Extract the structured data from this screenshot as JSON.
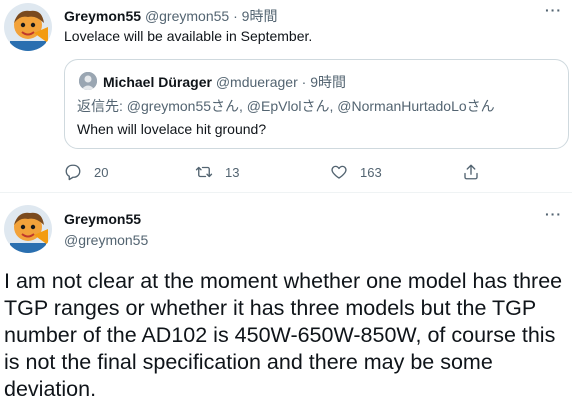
{
  "tweet": {
    "author_name": "Greymon55",
    "author_handle": "@greymon55",
    "separator": "·",
    "time": "9時間",
    "text": "Lovelace will be available in September.",
    "more": "···"
  },
  "quote": {
    "author_name": "Michael Dürager",
    "author_handle": "@mduerager",
    "separator": "·",
    "time": "9時間",
    "reply_to": "返信先: @greymon55さん, @EpVlolさん, @NormanHurtadoLoさん",
    "text": "When will lovelace hit ground?"
  },
  "actions": {
    "reply_icon": "reply-icon",
    "reply_count": "20",
    "retweet_icon": "retweet-icon",
    "retweet_count": "13",
    "like_icon": "heart-icon",
    "like_count": "163",
    "share_icon": "share-icon"
  },
  "main_tweet": {
    "author_name": "Greymon55",
    "author_handle": "@greymon55",
    "more": "···",
    "text": "I am not clear at the moment whether one model has three TGP ranges or whether it has three models but the TGP number of the AD102 is 450W-650W-850W, of course this is not the final specification and there may be some deviation."
  },
  "colors": {
    "text": "#0f1419",
    "secondary": "#536471",
    "border": "#cfd9de"
  }
}
